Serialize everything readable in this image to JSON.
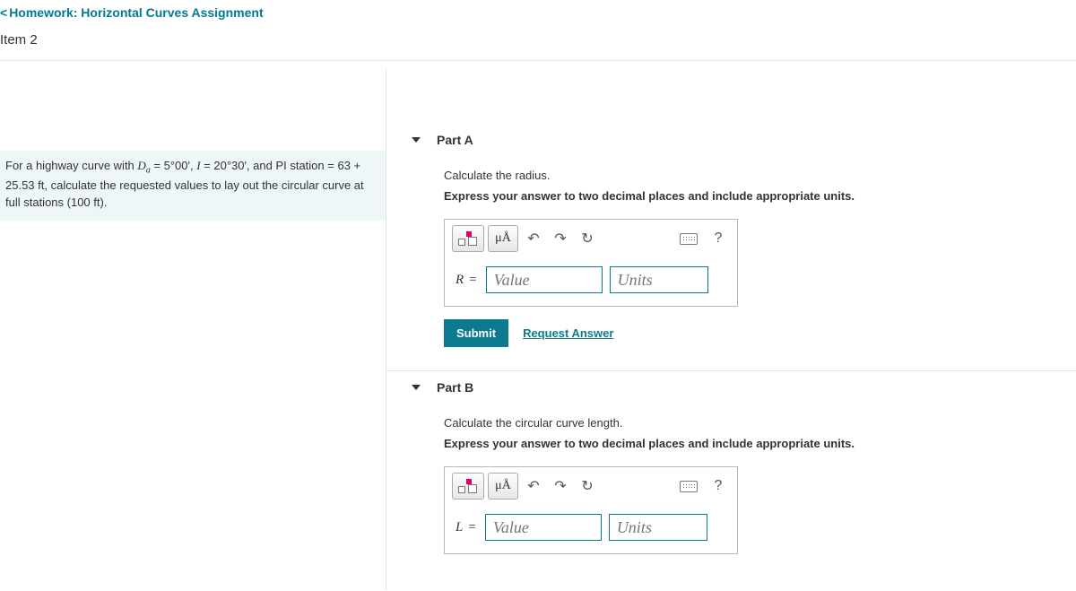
{
  "header": {
    "back_link": "Homework: Horizontal Curves Assignment",
    "item_label": "Item 2"
  },
  "problem": {
    "text_prefix": "For a highway curve with ",
    "Da_sym": "D",
    "Da_sub": "a",
    "eq": " = ",
    "Da_val": "5°00′",
    "comma1": ", ",
    "I_sym": "I",
    "I_val": "20°30′",
    "pi_text": ", and PI station ",
    "pi_eq": "= ",
    "pi_val": "63 + 25.53 ft",
    "tail": ", calculate the requested values to lay out the circular curve at full stations (100 ",
    "ft": "ft",
    "end": ")."
  },
  "parts": {
    "a": {
      "title": "Part A",
      "instr1": "Calculate the radius.",
      "instr2": "Express your answer to two decimal places and include appropriate units.",
      "var": "R",
      "value_ph": "Value",
      "units_ph": "Units",
      "submit": "Submit",
      "request": "Request Answer",
      "help_q": "?"
    },
    "b": {
      "title": "Part B",
      "instr1": "Calculate the circular curve length.",
      "instr2": "Express your answer to two decimal places and include appropriate units.",
      "var": "L",
      "value_ph": "Value",
      "units_ph": "Units",
      "help_q": "?"
    }
  }
}
